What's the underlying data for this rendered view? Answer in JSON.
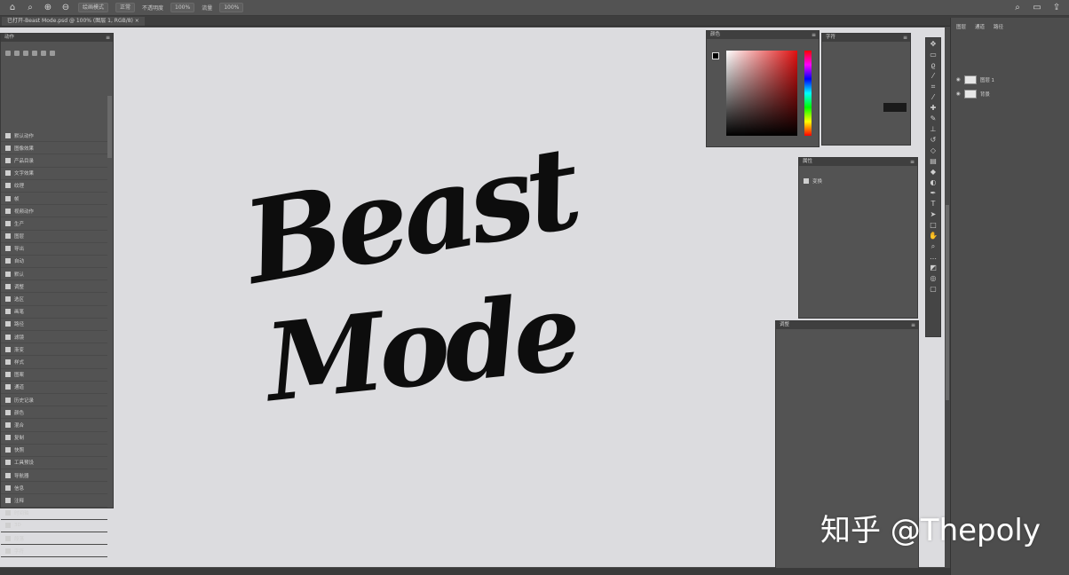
{
  "topbar": {
    "chips": [
      "绘画模式",
      "正常",
      "不透明度",
      "100%",
      "流量",
      "100%"
    ]
  },
  "document_tab": {
    "title": "已打开-Beast Mode.psd @ 100% (图层 1, RGB/8) ×"
  },
  "left_panel": {
    "title": "动作",
    "items": [
      "默认动作",
      "图像效果",
      "产品目录",
      "文字效果",
      "纹理",
      "帧",
      "视频动作",
      "生产",
      "图层",
      "导出",
      "自动",
      "默认",
      "调整",
      "选区",
      "画笔",
      "路径",
      "滤镜",
      "渐变",
      "样式",
      "图案",
      "通道",
      "历史记录",
      "颜色",
      "混合",
      "复制",
      "快照",
      "工具预设",
      "导航器",
      "信息",
      "注释",
      "时间轴",
      "3D",
      "段落",
      "字符"
    ]
  },
  "color_panel": {
    "title": "颜色",
    "accent_color": "#e01010"
  },
  "char_panel": {
    "title": "字符"
  },
  "props_panel": {
    "title": "属性",
    "section": "变换"
  },
  "layers_mid_panel": {
    "title": "调整"
  },
  "layers_panel": {
    "tabs": [
      "图层",
      "通道",
      "路径"
    ],
    "layers": [
      "图层 1",
      "背景"
    ]
  },
  "artwork": {
    "line1": "Beast",
    "line2": "Mode"
  },
  "watermark": {
    "text": "知乎 @Thepoly"
  }
}
